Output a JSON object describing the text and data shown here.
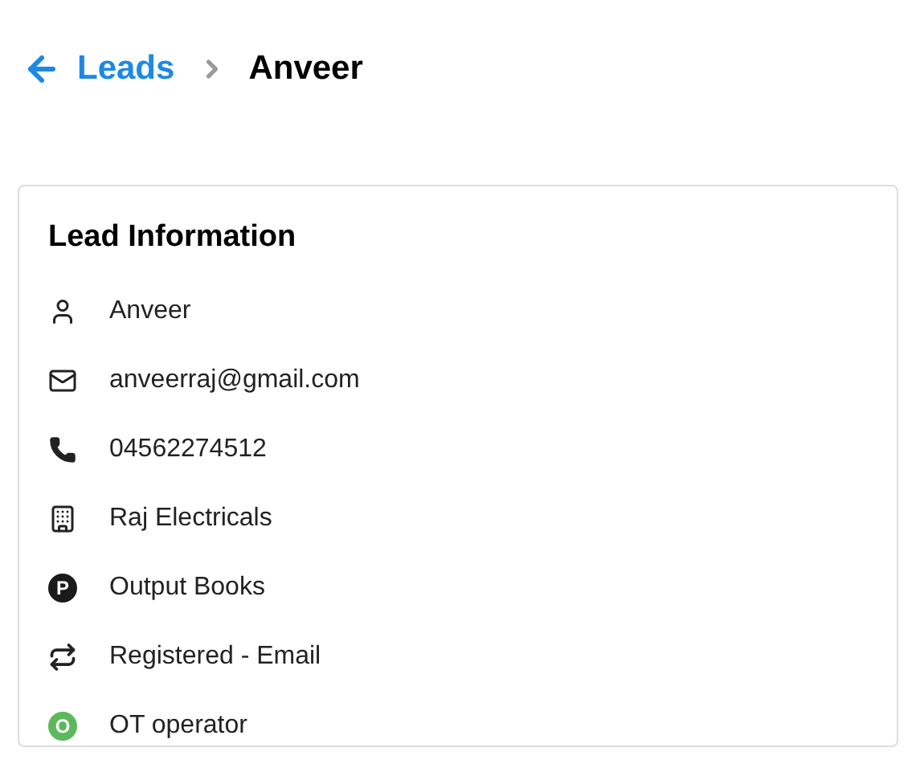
{
  "breadcrumb": {
    "parent": "Leads",
    "current": "Anveer"
  },
  "card": {
    "title": "Lead Information",
    "items": [
      {
        "kind": "user",
        "text": "Anveer"
      },
      {
        "kind": "email",
        "text": "anveerraj@gmail.com"
      },
      {
        "kind": "phone",
        "text": "04562274512"
      },
      {
        "kind": "building",
        "text": "Raj Electricals"
      },
      {
        "kind": "letter",
        "letter": "P",
        "color": "#1a1a1a",
        "text": "Output Books"
      },
      {
        "kind": "repeat",
        "text": "Registered - Email"
      },
      {
        "kind": "letter",
        "letter": "O",
        "color": "#5cb85c",
        "text": "OT operator"
      }
    ]
  }
}
